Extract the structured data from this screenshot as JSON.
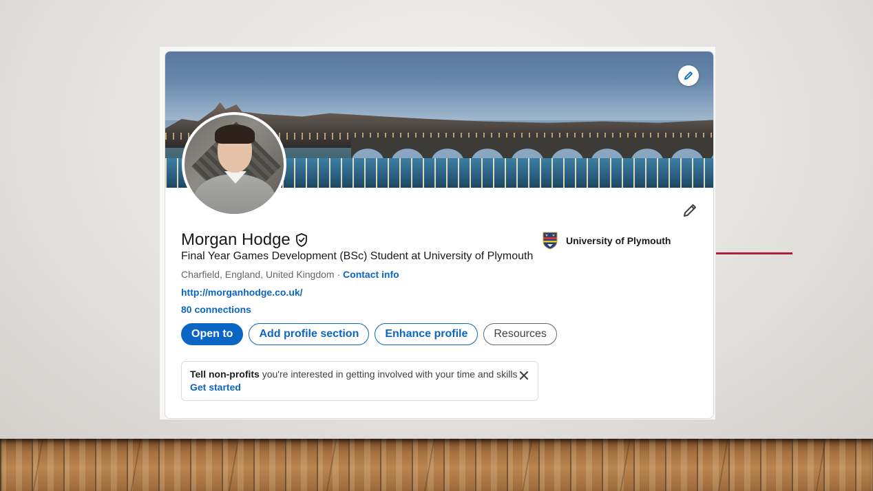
{
  "profile": {
    "name": "Morgan Hodge",
    "verified_icon": "shield-check-icon",
    "headline": "Final Year Games Development (BSc) Student at University of Plymouth",
    "location": "Charfield, England, United Kingdom",
    "separator": " · ",
    "contact_info": "Contact info",
    "website": "http://morganhodge.co.uk/",
    "connections": "80 connections"
  },
  "education": {
    "school": "University of Plymouth",
    "icon": "university-crest-icon"
  },
  "actions": {
    "open_to": "Open to",
    "add_section": "Add profile section",
    "enhance": "Enhance profile",
    "resources": "Resources"
  },
  "notice": {
    "bold": "Tell non-profits",
    "text": " you're interested in getting involved with your time and skills",
    "link": "Get started",
    "close_icon": "close-icon"
  },
  "colors": {
    "brand_blue": "#0a66c2",
    "accent_red": "#b01e3c"
  }
}
